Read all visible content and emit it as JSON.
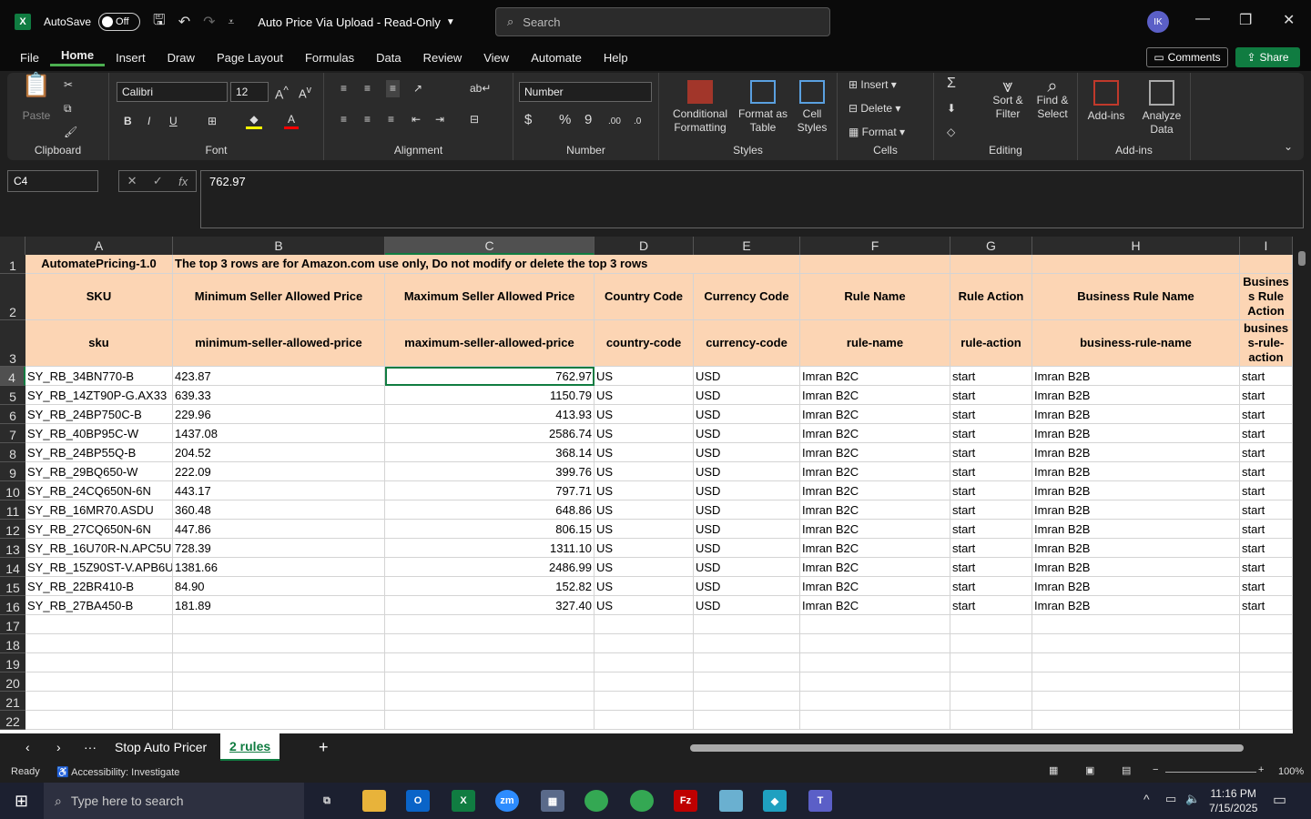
{
  "titlebar": {
    "autosave_label": "AutoSave",
    "toggle_label": "Off",
    "doc_title": "Auto Price Via Upload  -  Read-Only",
    "search_placeholder": "Search",
    "avatar": "IK"
  },
  "menu": [
    "File",
    "Home",
    "Insert",
    "Draw",
    "Page Layout",
    "Formulas",
    "Data",
    "Review",
    "View",
    "Automate",
    "Help"
  ],
  "comments_label": "Comments",
  "share_label": "Share",
  "ribbon": {
    "clipboard": {
      "label": "Clipboard",
      "paste": "Paste"
    },
    "font": {
      "label": "Font",
      "font_name": "Calibri",
      "font_size": "12"
    },
    "alignment": {
      "label": "Alignment"
    },
    "number": {
      "label": "Number",
      "format": "Number"
    },
    "styles": {
      "label": "Styles",
      "conditional": "Conditional",
      "conditional2": "Formatting",
      "format_as": "Format as",
      "format_as2": "Table",
      "cell": "Cell",
      "cell2": "Styles"
    },
    "cells": {
      "label": "Cells",
      "insert": "Insert",
      "delete": "Delete",
      "format": "Format"
    },
    "editing": {
      "label": "Editing",
      "sort": "Sort &",
      "sort2": "Filter",
      "find": "Find &",
      "find2": "Select"
    },
    "addins": {
      "label": "Add-ins",
      "addins": "Add-ins",
      "analyze": "Analyze",
      "analyze2": "Data"
    }
  },
  "formula": {
    "cell_ref": "C4",
    "value": "762.97"
  },
  "columns": [
    "A",
    "B",
    "C",
    "D",
    "E",
    "F",
    "G",
    "H",
    "I"
  ],
  "rows_numbers": [
    "1",
    "2",
    "3",
    "4",
    "5",
    "6",
    "7",
    "8",
    "9",
    "10",
    "11",
    "12",
    "13",
    "14",
    "15",
    "16",
    "17",
    "18",
    "19",
    "20",
    "21",
    "22"
  ],
  "row1": {
    "a": "AutomatePricing-1.0",
    "b": "The top 3 rows are for Amazon.com use only, Do not modify or delete the top 3 rows"
  },
  "row2": [
    "SKU",
    "Minimum Seller Allowed Price",
    "Maximum Seller Allowed Price",
    "Country Code",
    "Currency Code",
    "Rule Name",
    "Rule Action",
    "Business Rule Name",
    "Busines s Rule Action"
  ],
  "row3": [
    "sku",
    "minimum-seller-allowed-price",
    "maximum-seller-allowed-price",
    "country-code",
    "currency-code",
    "rule-name",
    "rule-action",
    "business-rule-name",
    "busines s-rule-action"
  ],
  "data": [
    [
      "SY_RB_34BN770-B",
      "423.87",
      "762.97",
      "US",
      "USD",
      "Imran B2C",
      "start",
      "Imran B2B",
      "start"
    ],
    [
      "SY_RB_14ZT90P-G.AX33",
      "639.33",
      "1150.79",
      "US",
      "USD",
      "Imran B2C",
      "start",
      "Imran B2B",
      "start"
    ],
    [
      "SY_RB_24BP750C-B",
      "229.96",
      "413.93",
      "US",
      "USD",
      "Imran B2C",
      "start",
      "Imran B2B",
      "start"
    ],
    [
      "SY_RB_40BP95C-W",
      "1437.08",
      "2586.74",
      "US",
      "USD",
      "Imran B2C",
      "start",
      "Imran B2B",
      "start"
    ],
    [
      "SY_RB_24BP55Q-B",
      "204.52",
      "368.14",
      "US",
      "USD",
      "Imran B2C",
      "start",
      "Imran B2B",
      "start"
    ],
    [
      "SY_RB_29BQ650-W",
      "222.09",
      "399.76",
      "US",
      "USD",
      "Imran B2C",
      "start",
      "Imran B2B",
      "start"
    ],
    [
      "SY_RB_24CQ650N-6N",
      "443.17",
      "797.71",
      "US",
      "USD",
      "Imran B2C",
      "start",
      "Imran B2B",
      "start"
    ],
    [
      "SY_RB_16MR70.ASDU",
      "360.48",
      "648.86",
      "US",
      "USD",
      "Imran B2C",
      "start",
      "Imran B2B",
      "start"
    ],
    [
      "SY_RB_27CQ650N-6N",
      "447.86",
      "806.15",
      "US",
      "USD",
      "Imran B2C",
      "start",
      "Imran B2B",
      "start"
    ],
    [
      "SY_RB_16U70R-N.APC5U",
      "728.39",
      "1311.10",
      "US",
      "USD",
      "Imran B2C",
      "start",
      "Imran B2B",
      "start"
    ],
    [
      "SY_RB_15Z90ST-V.APB6U",
      "1381.66",
      "2486.99",
      "US",
      "USD",
      "Imran B2C",
      "start",
      "Imran B2B",
      "start"
    ],
    [
      "SY_RB_22BR410-B",
      "84.90",
      "152.82",
      "US",
      "USD",
      "Imran B2C",
      "start",
      "Imran B2B",
      "start"
    ],
    [
      "SY_RB_27BA450-B",
      "181.89",
      "327.40",
      "US",
      "USD",
      "Imran B2C",
      "start",
      "Imran B2B",
      "start"
    ]
  ],
  "tabs": [
    "Stop Auto Pricer",
    "2 rules"
  ],
  "status": {
    "ready": "Ready",
    "accessibility": "Accessibility: Investigate",
    "zoom": "100%"
  },
  "taskbar": {
    "search_placeholder": "Type here to search",
    "time": "11:16 PM",
    "date": "7/15/2025"
  }
}
